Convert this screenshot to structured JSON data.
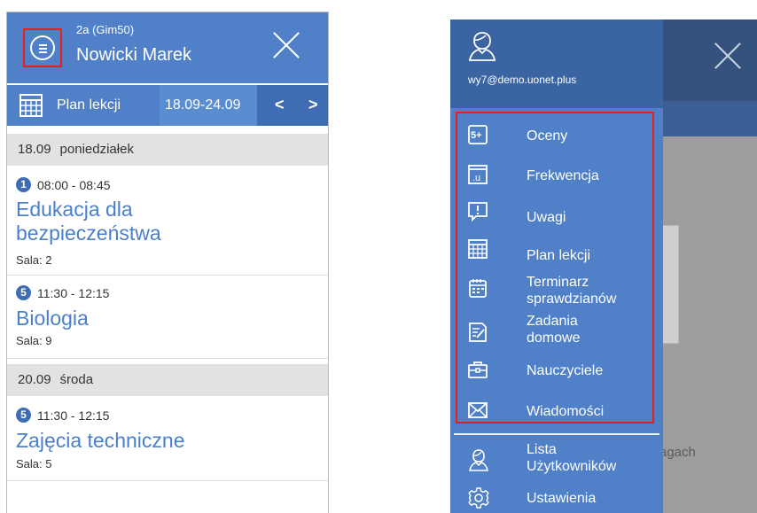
{
  "left_screen": {
    "header": {
      "class_label": "2a (Gim50)",
      "student_name": "Nowicki Marek"
    },
    "toolbar": {
      "section_label": "Plan lekcji",
      "date_range": "18.09-24.09",
      "prev_label": "<",
      "next_label": ">"
    },
    "days": [
      {
        "date": "18.09",
        "weekday": "poniedziałek",
        "lessons": [
          {
            "number": "1",
            "time": "08:00 - 08:45",
            "subject_line1": "Edukacja dla",
            "subject_line2": "bezpieczeństwa",
            "room": "Sala: 2"
          },
          {
            "number": "5",
            "time": "11:30 - 12:15",
            "subject_line1": "Biologia",
            "room": "Sala: 9"
          }
        ]
      },
      {
        "date": "20.09",
        "weekday": "środa",
        "lessons": [
          {
            "number": "5",
            "time": "11:30 - 12:15",
            "subject_line1": "Zajęcia techniczne",
            "room": "Sala: 5"
          }
        ]
      }
    ]
  },
  "right_screen": {
    "drawer": {
      "email": "wy7@demo.uonet.plus",
      "menu": [
        {
          "icon": "grades-icon",
          "label_line1": "Oceny"
        },
        {
          "icon": "attendance-icon",
          "label_line1": "Frekwencja"
        },
        {
          "icon": "notes-icon",
          "label_line1": "Uwagi"
        },
        {
          "icon": "timetable-icon",
          "label_line1": "Plan lekcji"
        },
        {
          "icon": "calendar-icon",
          "label_line1": "Terminarz",
          "label_line2": "sprawdzianów"
        },
        {
          "icon": "homework-icon",
          "label_line1": "Zadania",
          "label_line2": "domowe"
        },
        {
          "icon": "briefcase-icon",
          "label_line1": "Nauczyciele"
        },
        {
          "icon": "mail-icon",
          "label_line1": "Wiadomości"
        }
      ],
      "footer": [
        {
          "icon": "users-icon",
          "label_line1": "Lista",
          "label_line2": "Użytkowników"
        },
        {
          "icon": "settings-icon",
          "label_line1": "Ustawienia"
        }
      ]
    },
    "background_text": "agach"
  },
  "colors": {
    "primary": "#4f80c8",
    "primary_dark": "#3e6db3",
    "highlight": "#e0211f",
    "subject_text": "#4a7fcb",
    "day_header_bg": "#e2e2e2"
  }
}
